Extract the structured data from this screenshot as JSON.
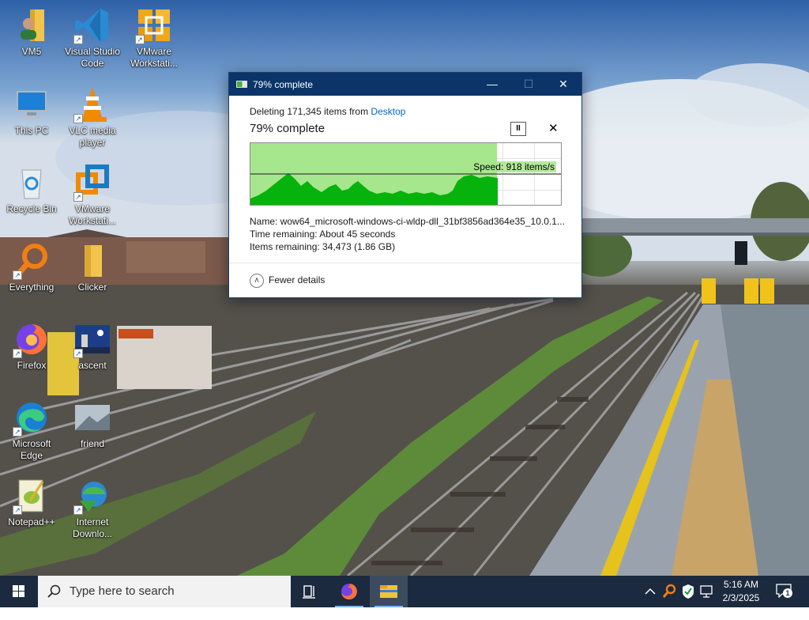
{
  "desktop": {
    "icons": [
      {
        "label": "VM5"
      },
      {
        "label": "Visual Studio Code"
      },
      {
        "label": "VMware Workstati..."
      },
      {
        "label": "This PC"
      },
      {
        "label": "VLC media player"
      },
      {
        "label": "Recycle Bin"
      },
      {
        "label": "VMware Workstati..."
      },
      {
        "label": "Everything"
      },
      {
        "label": "Clicker"
      },
      {
        "label": "Firefox"
      },
      {
        "label": "ascent"
      },
      {
        "label": "Microsoft Edge"
      },
      {
        "label": "friend"
      },
      {
        "label": "Notepad++"
      },
      {
        "label": "Internet Downlo..."
      }
    ]
  },
  "dialog": {
    "title": "79% complete",
    "subtitle_prefix": "Deleting 171,345 items from ",
    "subtitle_link": "Desktop",
    "heading": "79% complete",
    "pause_glyph": "II",
    "cancel_glyph": "✕",
    "progress_fraction": 0.79,
    "speed": "Speed: 918 items/s",
    "name_label": "Name:",
    "name_value": "wow64_microsoft-windows-ci-wldp-dll_31bf3856ad364e35_10.0.1...",
    "time_label": "Time remaining:",
    "time_value": "About 45 seconds",
    "items_label": "Items remaining:",
    "items_value": "34,473 (1.86 GB)",
    "fewer_details": "Fewer details",
    "minimize_glyph": "—",
    "maximize_glyph": "☐",
    "close_glyph": "✕"
  },
  "taskbar": {
    "search_placeholder": "Type here to search",
    "time": "5:16 AM",
    "date": "2/3/2025",
    "notification_count": "1"
  },
  "colors": {
    "titlebar": "#0b3568",
    "progress_fill": "#a6e68c",
    "graph_fill": "#06b20c",
    "link": "#0066cc",
    "taskbar": "#1b2a3e"
  }
}
